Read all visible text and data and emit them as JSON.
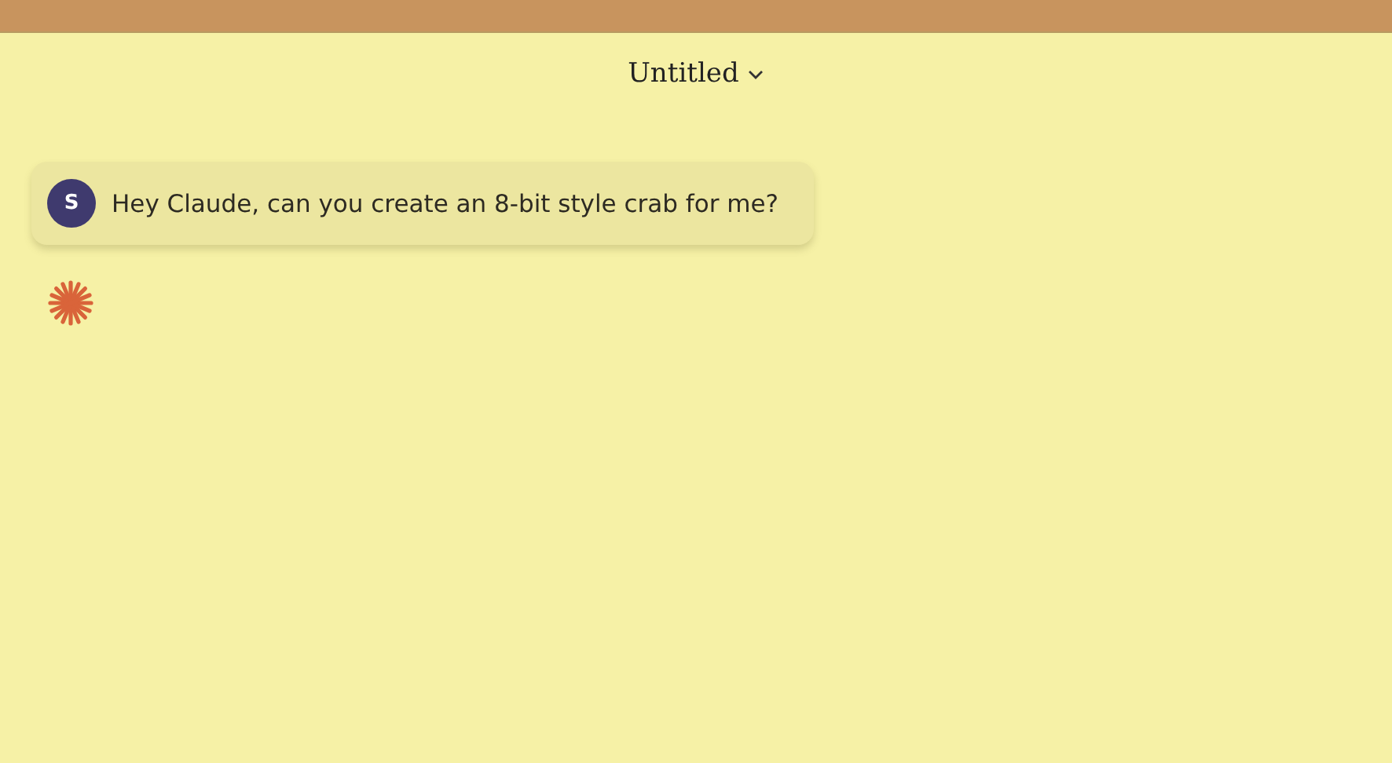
{
  "header": {
    "title": "Untitled"
  },
  "messages": [
    {
      "kind": "user",
      "avatar": "S",
      "text": "Hey Claude, can you create an 8-bit style crab for me?"
    },
    {
      "kind": "assistant"
    }
  ]
}
